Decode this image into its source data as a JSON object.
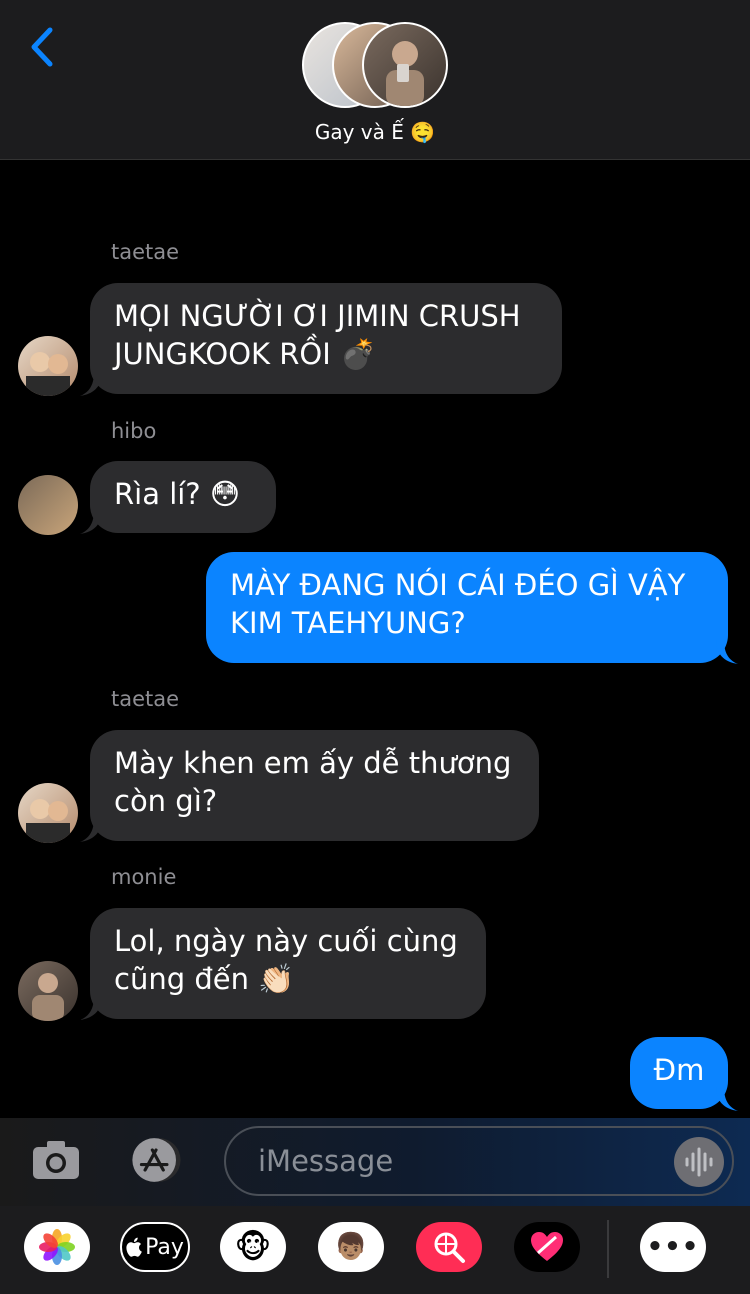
{
  "header": {
    "title": "Gay và Ế 🤤"
  },
  "messages": [
    {
      "sender": "taetae",
      "lines": [
        "MỌI NGƯỜI ƠI JIMIN CRUSH",
        "JUNGKOOK RỒI 💣"
      ]
    },
    {
      "sender": "hibo",
      "lines": [
        "Rìa lí? 😳"
      ]
    },
    {
      "sender": "",
      "lines": [
        "MÀY ĐANG NÓI CÁI ĐÉO GÌ VẬY",
        "KIM TAEHYUNG?"
      ]
    },
    {
      "sender": "taetae",
      "lines": [
        "Mày khen em ấy dễ thương",
        "còn gì?"
      ]
    },
    {
      "sender": "monie",
      "lines": [
        "Lol, ngày này cuối cùng",
        "cũng đến 👏🏻"
      ]
    },
    {
      "sender": "",
      "lines": [
        "Đm"
      ]
    }
  ],
  "composer": {
    "placeholder": "iMessage"
  },
  "drawer": {
    "apple_pay_label": "Pay",
    "more_label": "•••"
  }
}
